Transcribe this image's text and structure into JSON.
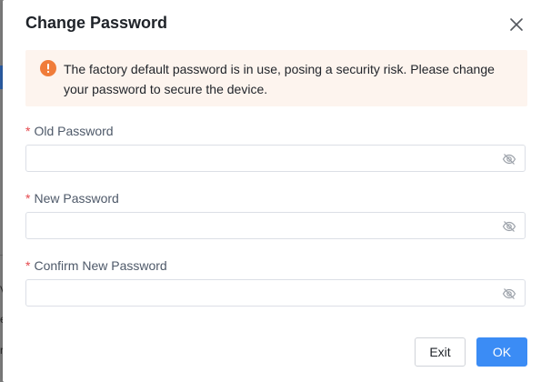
{
  "dialog": {
    "title": "Change Password",
    "close_icon": "close-icon"
  },
  "alert": {
    "icon": "exclamation-circle-icon",
    "message": "The factory default password is in use, posing a security risk. Please change your password to secure the device.",
    "icon_color": "#f07c3a",
    "background_color": "#fdf4ee"
  },
  "fields": [
    {
      "label": "Old Password",
      "required_mark": "*",
      "value": "",
      "visibility_icon": "eye-off-icon"
    },
    {
      "label": "New Password",
      "required_mark": "*",
      "value": "",
      "visibility_icon": "eye-off-icon"
    },
    {
      "label": "Confirm New Password",
      "required_mark": "*",
      "value": "",
      "visibility_icon": "eye-off-icon"
    }
  ],
  "buttons": {
    "exit_label": "Exit",
    "ok_label": "OK",
    "ok_color": "#3b8cf5"
  },
  "background_fragments": [
    "V",
    "e",
    "r"
  ]
}
